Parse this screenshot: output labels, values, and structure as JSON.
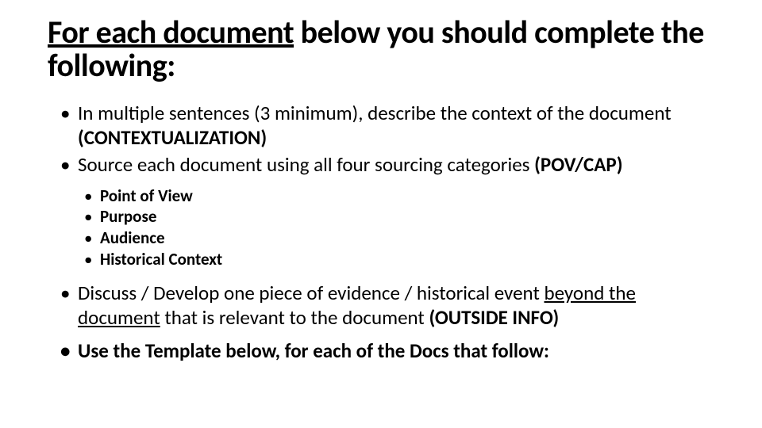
{
  "title": {
    "underlined": "For each document",
    "rest": " below you should complete the following:"
  },
  "b1": {
    "lead": "In multiple sentences (3 minimum), describe the context of the document ",
    "strong": "(CONTEXTUALIZATION)"
  },
  "b2": {
    "lead": "Source each document using all four sourcing categories ",
    "strong": "(POV/CAP)"
  },
  "sub": {
    "s1": "Point of View",
    "s2": "Purpose",
    "s3": "Audience",
    "s4": "Historical Context"
  },
  "b3": {
    "lead": "Discuss / Develop one piece of evidence / historical event ",
    "und": "beyond the document",
    "mid": " that is relevant to the document ",
    "strong": "(OUTSIDE INFO)"
  },
  "b4": {
    "text": "Use the Template below, for each of the Docs that follow:"
  }
}
